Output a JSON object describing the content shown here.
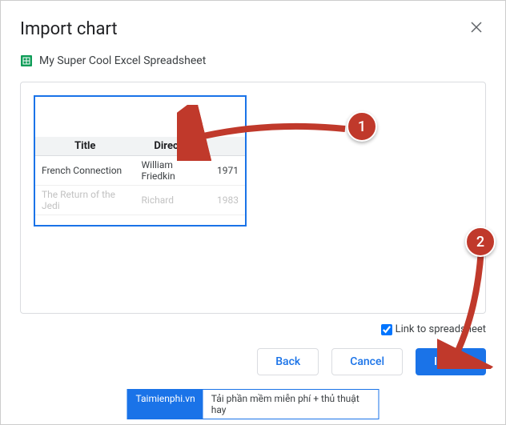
{
  "dialog": {
    "title": "Import chart",
    "file_name": "My Super Cool Excel Spreadsheet",
    "link_checkbox_label": "Link to spreadsheet",
    "back_label": "Back",
    "cancel_label": "Cancel",
    "import_label": "Import"
  },
  "table": {
    "col1": "Title",
    "col2": "Director",
    "rows": [
      {
        "title": "French Connection",
        "director": "William Friedkin",
        "year": "1971"
      },
      {
        "title": "The Return of the Jedi",
        "director": "Richard",
        "year": "1983"
      }
    ]
  },
  "annotations": {
    "badge1": "1",
    "badge2": "2"
  },
  "watermark": {
    "left": "Taimienphi.vn",
    "right": "Tải phần mềm miễn phí + thủ thuật hay"
  }
}
